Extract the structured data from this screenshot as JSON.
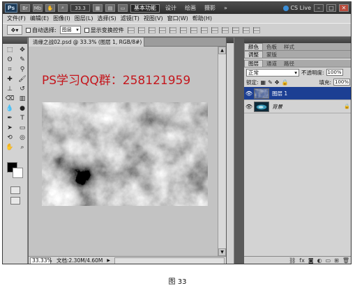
{
  "app": {
    "logo": "Ps",
    "zoom": "33.3",
    "workspace_active": "基本功能",
    "workspaces": [
      "设计",
      "绘画",
      "摄影"
    ],
    "more": "»",
    "cs_live": "CS Live",
    "win_min": "–",
    "win_max": "□",
    "win_close": "✕"
  },
  "menu": [
    "文件(F)",
    "编辑(E)",
    "图像(I)",
    "图层(L)",
    "选择(S)",
    "滤镜(T)",
    "视图(V)",
    "窗口(W)",
    "帮助(H)"
  ],
  "options": {
    "auto_select_label": "自动选择:",
    "auto_select_value": "图层",
    "show_transform_label": "显示变换控件"
  },
  "document": {
    "tab_title": "清缘之战02.psd @ 33.3% (图层 1, RGB/8#) *",
    "tab_close": "×",
    "watermark": "PS学习QQ群：258121959",
    "status_zoom": "33.33%",
    "status_info": "文档:2.30M/4.60M",
    "status_arrow": "▶"
  },
  "panels": {
    "top_tabs": [
      "颜色",
      "色板",
      "样式"
    ],
    "mid_tabs": [
      "调整",
      "蒙版"
    ],
    "layer_tabs": [
      "图层",
      "通道",
      "路径"
    ],
    "blend_mode": "正常",
    "opacity_label": "不透明度:",
    "opacity_value": "100%",
    "lock_label": "锁定:",
    "fill_label": "填充:",
    "fill_value": "100%",
    "layers": [
      {
        "name": "图层 1",
        "selected": true,
        "italic": false
      },
      {
        "name": "背景",
        "selected": false,
        "italic": true
      }
    ]
  },
  "caption": "图 33",
  "colors": {
    "accent": "#1c3f93",
    "watermark": "#c4161c",
    "foreground": "#000000",
    "background": "#ffffff"
  }
}
